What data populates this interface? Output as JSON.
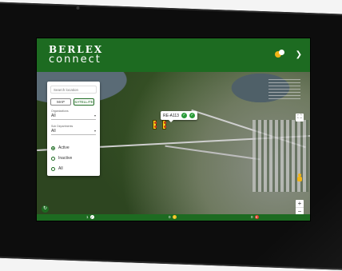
{
  "header": {
    "logo_top": "BERLEX",
    "logo_bottom": "connect",
    "notification_icon": "notification-dot-icon",
    "menu_icon": "chevron-down-icon"
  },
  "filters": {
    "search_placeholder": "Search location",
    "map_label": "MAP",
    "satellite_label": "SATELLITE",
    "organizations_label": "Organizations",
    "organizations_value": "All",
    "sub_departments_label": "Sub Departments",
    "sub_departments_value": "All",
    "status_options": [
      {
        "label": "Active",
        "selected": true
      },
      {
        "label": "Inactive",
        "selected": false
      },
      {
        "label": "All",
        "selected": false
      }
    ]
  },
  "map": {
    "popup_label": "RE-A113",
    "fullscreen_icon": "fullscreen-icon",
    "zoom_in": "+",
    "zoom_out": "−"
  },
  "status_bar": {
    "count_green": "1",
    "count_yellow": "0",
    "count_red": "0"
  },
  "colors": {
    "brand_green": "#1d6b21",
    "warning_yellow": "#f2c11c",
    "alert_red": "#e23b2d"
  }
}
